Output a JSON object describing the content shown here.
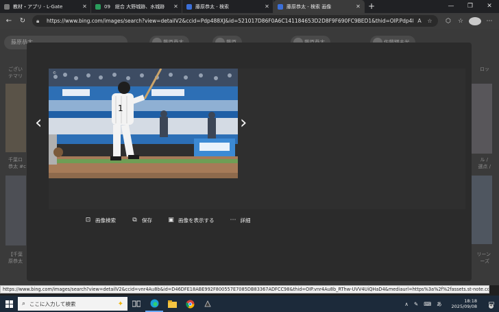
{
  "tabs": [
    {
      "title": "教材・アプリ - L-Gate",
      "favicon_color": "#777777",
      "active": false
    },
    {
      "title": "09　総合 大野城跡、水城跡",
      "favicon_color": "#2a9d5c",
      "active": false
    },
    {
      "title": "藤原恭太 - 検索",
      "favicon_color": "#3b6fd8",
      "active": false
    },
    {
      "title": "藤原恭太 - 検索 画像",
      "favicon_color": "#3b6fd8",
      "active": true
    }
  ],
  "address_bar": {
    "url": "https://www.bing.com/images/search?view=detailV2&ccid=Pdp488XJ&id=521017D86F0A6C141184653D2D8F9F690FC9BED1&thid=OIP.Pdp488XJ1xD..."
  },
  "background_page": {
    "search_query": "藤原恭太",
    "chips": [
      "藤原恭太",
      "藤原",
      "藤原恭太",
      "佐藤輝未光"
    ],
    "left_texts": [
      "ござい",
      "テマリ",
      "千葉ロ",
      "恭太 #c",
      "【千葉",
      "原恭太"
    ],
    "right_texts": [
      "ロッ",
      "ル /",
      "選点 /",
      "リーン",
      "ーズ"
    ]
  },
  "modal": {
    "actions": [
      {
        "label": "画像検索",
        "icon": "visual-search-icon"
      },
      {
        "label": "保存",
        "icon": "save-icon"
      },
      {
        "label": "画像を表示する",
        "icon": "view-image-icon"
      },
      {
        "label": "詳細",
        "icon": "more-icon"
      }
    ],
    "photo_alt": "藤原恭太"
  },
  "status_url": "https://www.bing.com/images/search?view=detailV2&ccid=vnr4Au8b&id=D46DFE18ABE992F800557E7085DB83367ADFCC98&thid=OIP.vnr4Au8b_RThw-UVV4UiQHaD4&mediaurl=https%3a%2f%2fassets.st-note.com%2fproductio...",
  "taskbar": {
    "search_placeholder": "ここに入力して検索",
    "time": "18:18",
    "date": "2025/09/08",
    "ime": "あ",
    "notifications": "4"
  }
}
